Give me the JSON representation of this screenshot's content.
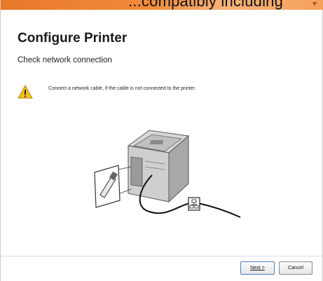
{
  "header": {
    "banner_text": "...compatibly including",
    "title": "Configure Printer",
    "subtitle": "Check network connection"
  },
  "warning": {
    "icon": "warning-icon",
    "message": "Connect a network cable, if the cable is not connected to the printer."
  },
  "illustration": {
    "description_icon": "network-cable-illustration"
  },
  "footer": {
    "next_label": "Next >",
    "cancel_label": "Cancel"
  },
  "colors": {
    "banner": "#f08a3a",
    "warning": "#f2c01e",
    "next_border": "#4c7fc4"
  }
}
